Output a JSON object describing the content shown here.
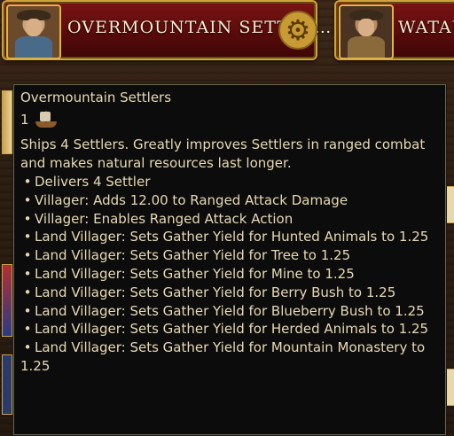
{
  "cards": [
    {
      "title": "OVERMOUNTAIN SETTLE…",
      "portrait": "frontiersman-portrait"
    },
    {
      "title": "WATAU",
      "portrait": "settler-portrait"
    }
  ],
  "tooltip": {
    "title": "Overmountain Settlers",
    "quantity": "1",
    "icon": "ship-icon",
    "description": "Ships 4 Settlers. Greatly improves Settlers in ranged combat and makes natural resources last longer.",
    "bullet": "•",
    "effects": [
      "Delivers 4 Settler",
      "Villager: Adds 12.00 to Ranged Attack Damage",
      "Villager: Enables Ranged Attack Action",
      "Land Villager: Sets Gather Yield for Hunted Animals to 1.25",
      "Land Villager: Sets Gather Yield for Tree to 1.25",
      "Land Villager: Sets Gather Yield for Mine to 1.25",
      "Land Villager: Sets Gather Yield for Berry Bush to 1.25",
      "Land Villager: Sets Gather Yield for Blueberry Bush to 1.25",
      "Land Villager: Sets Gather Yield for Herded Animals to 1.25",
      "Land Villager: Sets Gather Yield for Mountain Monastery to 1.25"
    ]
  },
  "colors": {
    "card_red": "#6a0e0e",
    "gold_border": "#d0a33c",
    "tooltip_bg": "#0c0c0c",
    "tooltip_text": "#e8d9b5"
  }
}
